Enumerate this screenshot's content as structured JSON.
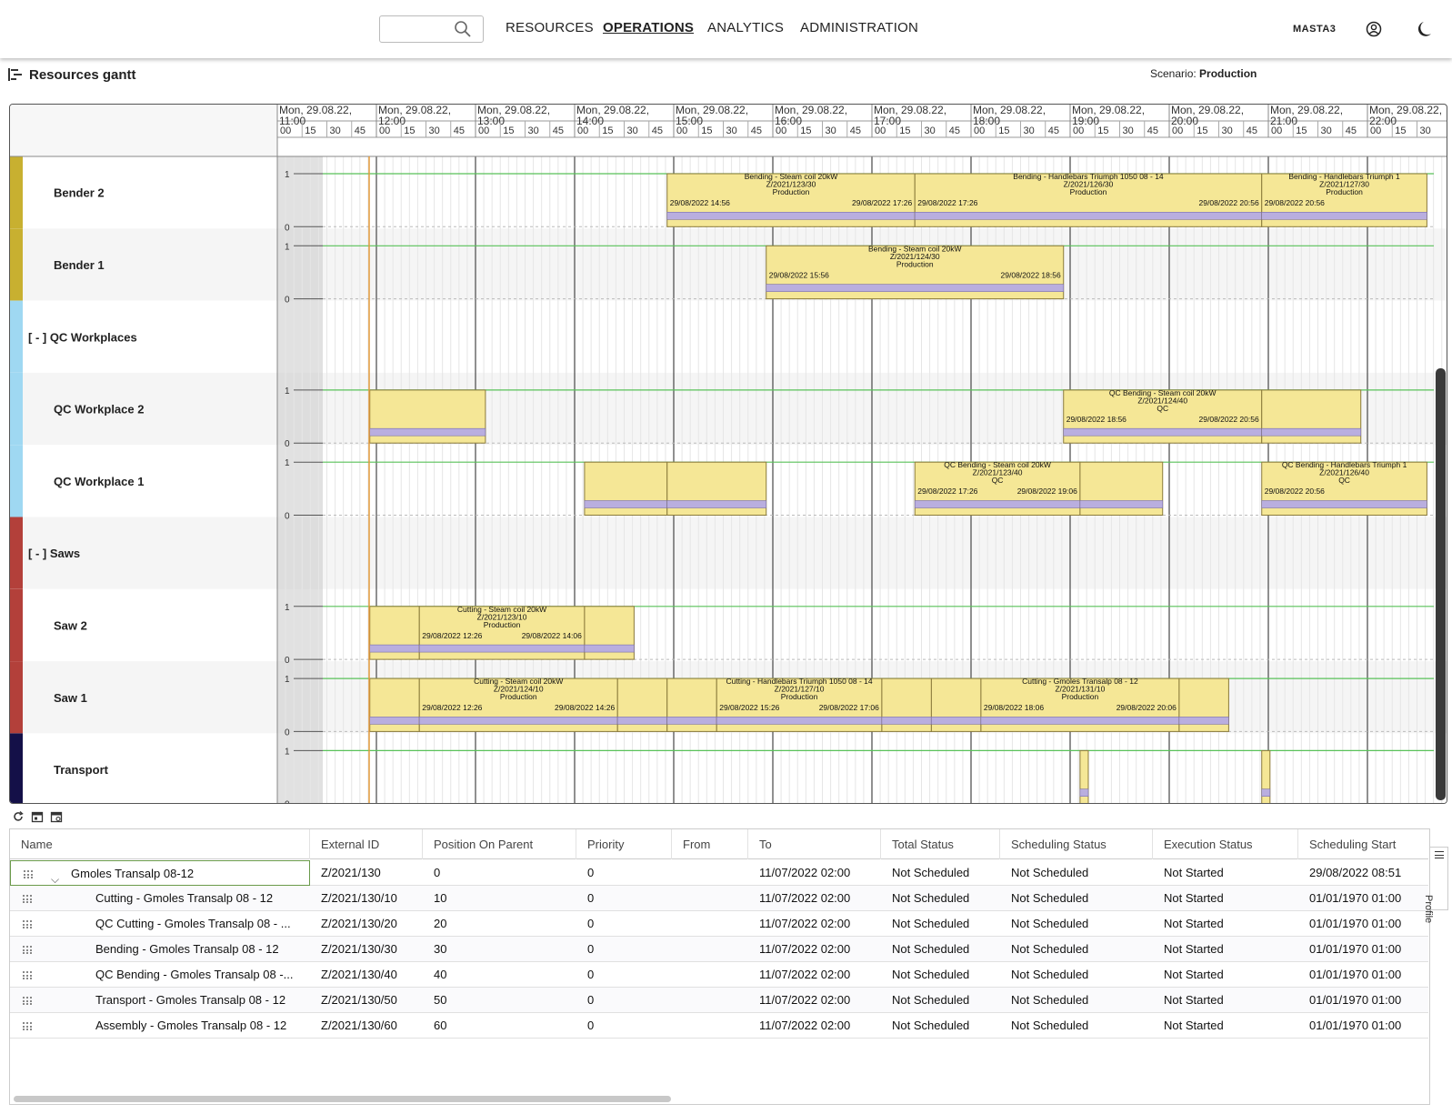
{
  "nav": {
    "search_placeholder": "",
    "items": [
      "RESOURCES",
      "OPERATIONS",
      "ANALYTICS",
      "ADMINISTRATION"
    ],
    "active": "OPERATIONS",
    "username": "MASTA3"
  },
  "page": {
    "title": "Resources gantt",
    "scenario_label": "Scenario:",
    "scenario_value": "Production"
  },
  "gantt": {
    "hours": [
      "Mon, 29.08.22, 11:00",
      "Mon, 29.08.22, 12:00",
      "Mon, 29.08.22, 13:00",
      "Mon, 29.08.22, 14:00",
      "Mon, 29.08.22, 15:00",
      "Mon, 29.08.22, 16:00",
      "Mon, 29.08.22, 17:00",
      "Mon, 29.08.22, 18:00",
      "Mon, 29.08.22, 19:00",
      "Mon, 29.08.22, 20:00",
      "Mon, 29.08.22, 21:00",
      "Mon, 29.08.22, 22:00"
    ],
    "minute_ticks": [
      "00",
      "15",
      "30",
      "45"
    ],
    "rows": [
      {
        "label": "Bender 2",
        "group": false,
        "color": "#c8b030"
      },
      {
        "label": "Bender 1",
        "group": false,
        "color": "#c8b030"
      },
      {
        "label": "[ - ]  QC Workplaces",
        "group": true,
        "color": "#9fd8f2"
      },
      {
        "label": "QC Workplace 2",
        "group": false,
        "color": "#9fd8f2"
      },
      {
        "label": "QC Workplace 1",
        "group": false,
        "color": "#9fd8f2"
      },
      {
        "label": "[ - ]  Saws",
        "group": true,
        "color": "#b3403a"
      },
      {
        "label": "Saw 2",
        "group": false,
        "color": "#b3403a"
      },
      {
        "label": "Saw 1",
        "group": false,
        "color": "#b3403a"
      },
      {
        "label": "Transport",
        "group": false,
        "color": "#141048"
      }
    ],
    "axis_ticks": [
      "1",
      "0"
    ],
    "bars": [
      {
        "row": 0,
        "start": "14:56",
        "end": "17:26",
        "lines": [
          "Bending - Steam coil 20kW",
          "Z/2021/123/30",
          "Production"
        ],
        "from": "29/08/2022 14:56",
        "to": "29/08/2022 17:26"
      },
      {
        "row": 0,
        "start": "17:26",
        "end": "20:56",
        "lines": [
          "Bending - Handlebars Triumph 1050 08 - 14",
          "Z/2021/126/30",
          "Production"
        ],
        "from": "29/08/2022 17:26",
        "to": "29/08/2022 20:56"
      },
      {
        "row": 0,
        "start": "20:56",
        "end": "22:36",
        "lines": [
          "Bending - Handlebars Triumph 1",
          "Z/2021/127/30",
          "Production"
        ],
        "from": "29/08/2022 20:56",
        "to": ""
      },
      {
        "row": 1,
        "start": "15:56",
        "end": "18:56",
        "lines": [
          "Bending - Steam coil 20kW",
          "Z/2021/124/30",
          "Production"
        ],
        "from": "29/08/2022 15:56",
        "to": "29/08/2022 18:56"
      },
      {
        "row": 3,
        "start": "11:56",
        "end": "13:06",
        "lines": [],
        "from": "",
        "to": ""
      },
      {
        "row": 3,
        "start": "18:56",
        "end": "20:56",
        "lines": [
          "QC Bending - Steam coil 20kW",
          "Z/2021/124/40",
          "QC"
        ],
        "from": "29/08/2022 18:56",
        "to": "29/08/2022 20:56"
      },
      {
        "row": 3,
        "start": "20:56",
        "end": "21:56",
        "lines": [],
        "from": "",
        "to": ""
      },
      {
        "row": 4,
        "start": "14:06",
        "end": "14:56",
        "lines": [],
        "from": "",
        "to": ""
      },
      {
        "row": 4,
        "start": "14:56",
        "end": "15:56",
        "lines": [],
        "from": "",
        "to": ""
      },
      {
        "row": 4,
        "start": "17:26",
        "end": "19:06",
        "lines": [
          "QC Bending - Steam coil 20kW",
          "Z/2021/123/40",
          "QC"
        ],
        "from": "29/08/2022 17:26",
        "to": "29/08/2022 19:06"
      },
      {
        "row": 4,
        "start": "19:06",
        "end": "19:56",
        "lines": [],
        "from": "",
        "to": ""
      },
      {
        "row": 4,
        "start": "20:56",
        "end": "22:36",
        "lines": [
          "QC Bending - Handlebars Triumph 1",
          "Z/2021/126/40",
          "QC"
        ],
        "from": "29/08/2022 20:56",
        "to": ""
      },
      {
        "row": 6,
        "start": "11:56",
        "end": "12:26",
        "lines": [],
        "from": "",
        "to": ""
      },
      {
        "row": 6,
        "start": "12:26",
        "end": "14:06",
        "lines": [
          "Cutting - Steam coil 20kW",
          "Z/2021/123/10",
          "Production"
        ],
        "from": "29/08/2022 12:26",
        "to": "29/08/2022 14:06"
      },
      {
        "row": 6,
        "start": "14:06",
        "end": "14:36",
        "lines": [],
        "from": "",
        "to": ""
      },
      {
        "row": 7,
        "start": "11:56",
        "end": "12:26",
        "lines": [],
        "from": "",
        "to": ""
      },
      {
        "row": 7,
        "start": "12:26",
        "end": "14:26",
        "lines": [
          "Cutting - Steam coil 20kW",
          "Z/2021/124/10",
          "Production"
        ],
        "from": "29/08/2022 12:26",
        "to": "29/08/2022 14:26"
      },
      {
        "row": 7,
        "start": "14:26",
        "end": "14:56",
        "lines": [],
        "from": "",
        "to": ""
      },
      {
        "row": 7,
        "start": "14:56",
        "end": "15:26",
        "lines": [],
        "from": "",
        "to": ""
      },
      {
        "row": 7,
        "start": "15:26",
        "end": "17:06",
        "lines": [
          "Cutting - Handlebars Triumph 1050 08 - 14",
          "Z/2021/127/10",
          "Production"
        ],
        "from": "29/08/2022 15:26",
        "to": "29/08/2022 17:06"
      },
      {
        "row": 7,
        "start": "17:06",
        "end": "17:36",
        "lines": [],
        "from": "",
        "to": ""
      },
      {
        "row": 7,
        "start": "17:36",
        "end": "18:06",
        "lines": [],
        "from": "",
        "to": ""
      },
      {
        "row": 7,
        "start": "18:06",
        "end": "20:06",
        "lines": [
          "Cutting - Gmoles Transalp 08 - 12",
          "Z/2021/131/10",
          "Production"
        ],
        "from": "29/08/2022 18:06",
        "to": "29/08/2022 20:06"
      },
      {
        "row": 7,
        "start": "20:06",
        "end": "20:36",
        "lines": [],
        "from": "",
        "to": ""
      },
      {
        "row": 8,
        "start": "19:06",
        "end": "19:11",
        "lines": [],
        "from": "",
        "to": ""
      },
      {
        "row": 8,
        "start": "20:56",
        "end": "21:01",
        "lines": [],
        "from": "",
        "to": ""
      }
    ]
  },
  "table": {
    "columns": [
      "Name",
      "External ID",
      "Position On Parent",
      "Priority",
      "From",
      "To",
      "Total Status",
      "Scheduling Status",
      "Execution Status",
      "Scheduling Start"
    ],
    "rows": [
      {
        "name": "Gmoles Transalp 08-12",
        "ext": "Z/2021/130",
        "pos": "0",
        "prio": "0",
        "from": "",
        "to": "11/07/2022 02:00",
        "total": "Not Scheduled",
        "sched": "Not Scheduled",
        "exec": "Not Started",
        "start": "29/08/2022 08:51"
      },
      {
        "name": "Cutting - Gmoles Transalp 08 - 12",
        "ext": "Z/2021/130/10",
        "pos": "10",
        "prio": "0",
        "from": "",
        "to": "11/07/2022 02:00",
        "total": "Not Scheduled",
        "sched": "Not Scheduled",
        "exec": "Not Started",
        "start": "01/01/1970 01:00"
      },
      {
        "name": "QC Cutting - Gmoles Transalp 08 - ...",
        "ext": "Z/2021/130/20",
        "pos": "20",
        "prio": "0",
        "from": "",
        "to": "11/07/2022 02:00",
        "total": "Not Scheduled",
        "sched": "Not Scheduled",
        "exec": "Not Started",
        "start": "01/01/1970 01:00"
      },
      {
        "name": "Bending - Gmoles Transalp 08 - 12",
        "ext": "Z/2021/130/30",
        "pos": "30",
        "prio": "0",
        "from": "",
        "to": "11/07/2022 02:00",
        "total": "Not Scheduled",
        "sched": "Not Scheduled",
        "exec": "Not Started",
        "start": "01/01/1970 01:00"
      },
      {
        "name": "QC Bending - Gmoles Transalp 08 -...",
        "ext": "Z/2021/130/40",
        "pos": "40",
        "prio": "0",
        "from": "",
        "to": "11/07/2022 02:00",
        "total": "Not Scheduled",
        "sched": "Not Scheduled",
        "exec": "Not Started",
        "start": "01/01/1970 01:00"
      },
      {
        "name": "Transport - Gmoles Transalp 08 - 12",
        "ext": "Z/2021/130/50",
        "pos": "50",
        "prio": "0",
        "from": "",
        "to": "11/07/2022 02:00",
        "total": "Not Scheduled",
        "sched": "Not Scheduled",
        "exec": "Not Started",
        "start": "01/01/1970 01:00"
      },
      {
        "name": "Assembly - Gmoles Transalp 08 - 12",
        "ext": "Z/2021/130/60",
        "pos": "60",
        "prio": "0",
        "from": "",
        "to": "11/07/2022 02:00",
        "total": "Not Scheduled",
        "sched": "Not Scheduled",
        "exec": "Not Started",
        "start": "01/01/1970 01:00"
      }
    ],
    "profile_label": "Profile"
  },
  "colors": {
    "bar_fill": "#f5e796",
    "bar_stripe": "#b9aedf",
    "capacity_line": "#59c159",
    "now_line": "#e39a3a"
  }
}
